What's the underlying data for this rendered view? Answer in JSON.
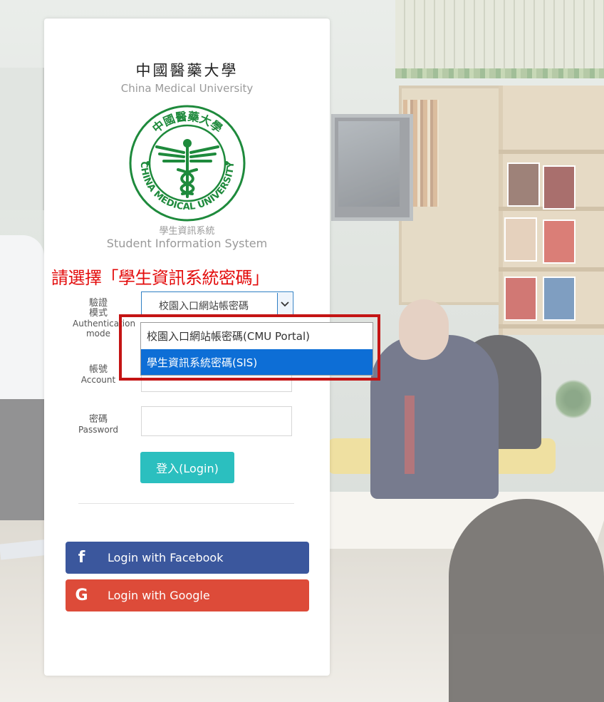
{
  "header": {
    "university_cn": "中國醫藥大學",
    "university_en": "China Medical University",
    "logo_ring_text": "CHINA MEDICAL UNIVERSITY",
    "logo_ring_cn": "中國醫藥大學",
    "system_cn": "學生資訊系統",
    "system_en": "Student Information System"
  },
  "instruction": "請選擇「學生資訊系統密碼」",
  "form": {
    "auth_label_cn": "驗證模式",
    "auth_label_cn_1": "驗證",
    "auth_label_cn_2": "模式",
    "auth_label_en_1": "Authentication",
    "auth_label_en_2": "mode",
    "auth_selected": "校園入口網站帳密(CMU Portal)",
    "auth_selected_display": "校園入口網站帳密碼",
    "auth_options": [
      "校園入口網站帳密碼(CMU Portal)",
      "學生資訊系統密碼(SIS)"
    ],
    "account_label_cn": "帳號",
    "account_label_en": "Account",
    "password_label_cn": "密碼",
    "password_label_en": "Password",
    "login_button": "登入(Login)"
  },
  "social": {
    "facebook_label": "Login with Facebook",
    "google_label": "Login with Google",
    "facebook_icon": "f",
    "google_icon": "G"
  },
  "colors": {
    "instruction": "#e30c0c",
    "login_button": "#2bbfbf",
    "facebook": "#3b579d",
    "google": "#dd4b39",
    "dropdown_selected": "#0d6ed6",
    "highlight_box": "#c41414",
    "logo_green": "#1e8a3c"
  }
}
